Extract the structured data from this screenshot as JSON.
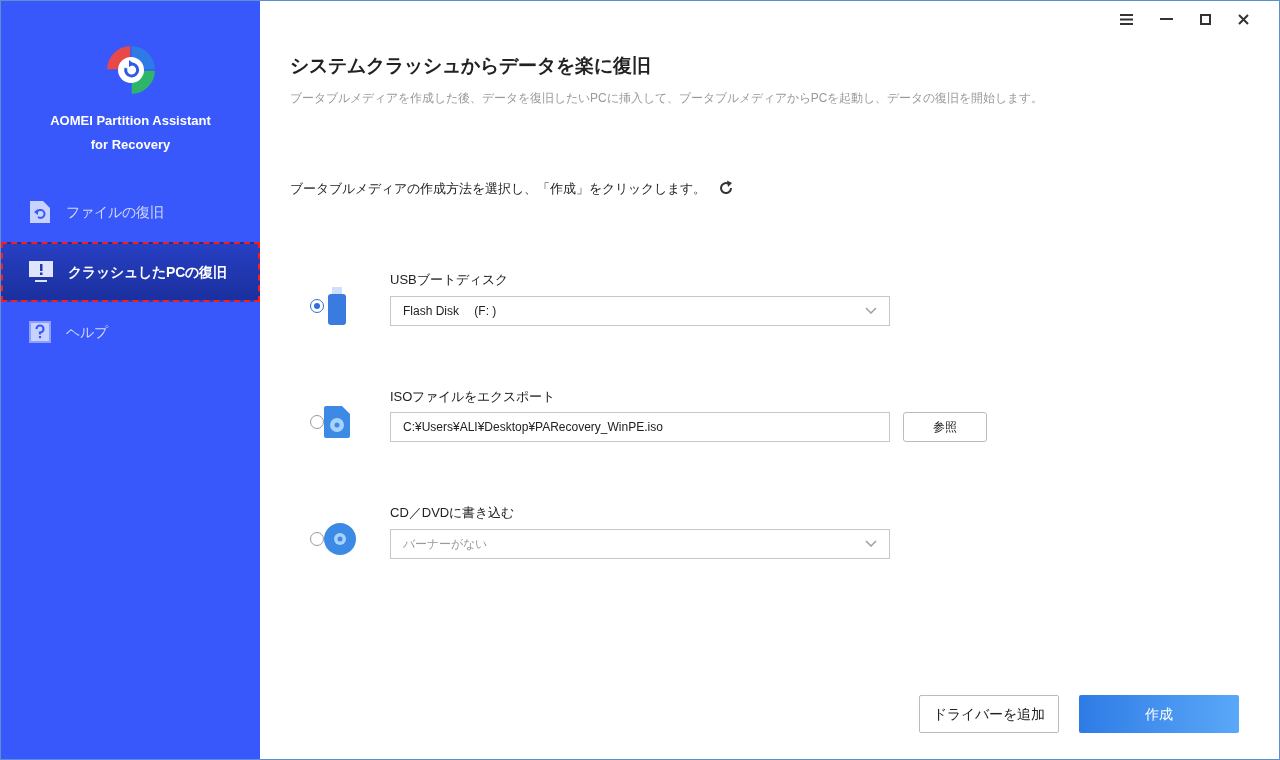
{
  "sidebar": {
    "app_name": "AOMEI Partition Assistant",
    "app_subtitle": "for Recovery",
    "items": [
      {
        "kind": "file",
        "label": "ファイルの復旧",
        "selected": false,
        "highlighted": false
      },
      {
        "kind": "pc",
        "label": "クラッシュしたPCの復旧",
        "selected": true,
        "highlighted": true
      },
      {
        "kind": "help",
        "label": "ヘルプ",
        "selected": false,
        "highlighted": false
      }
    ]
  },
  "main": {
    "title": "システムクラッシュからデータを楽に復旧",
    "description": "ブータブルメディアを作成した後、データを復旧したいPCに挿入して、ブータブルメディアからPCを起動し、データの復旧を開始します。",
    "instruction": "ブータブルメディアの作成方法を選択し、「作成」をクリックします。",
    "options": [
      {
        "kind": "usb",
        "label": "USBブートディスク",
        "selected": true,
        "field": {
          "kind": "dropdown",
          "value": "Flash Disk　 (F: )"
        }
      },
      {
        "kind": "iso",
        "label": "ISOファイルをエクスポート",
        "selected": false,
        "field": {
          "kind": "path",
          "value": "C:¥Users¥ALI¥Desktop¥PARecovery_WinPE.iso",
          "button": "参照"
        }
      },
      {
        "kind": "cd",
        "label": "CD／DVDに書き込む",
        "selected": false,
        "field": {
          "kind": "dropdown",
          "placeholder": "バーナーがない"
        }
      }
    ],
    "buttons": [
      {
        "kind": "secondary",
        "label": "ドライバーを追加"
      },
      {
        "kind": "primary",
        "label": "作成"
      }
    ]
  }
}
